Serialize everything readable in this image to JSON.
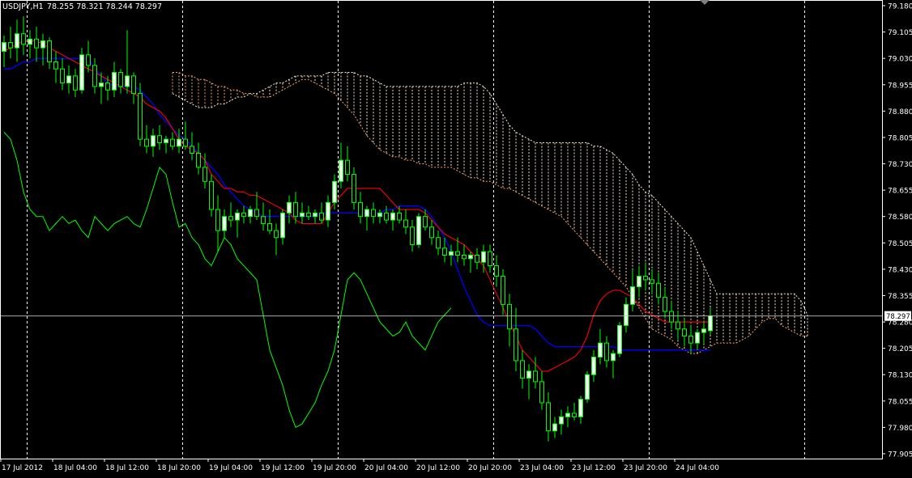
{
  "header": {
    "symbol": "USDJPY,H1",
    "ohlc": "78.255 78.321 78.244 78.297"
  },
  "current_price_label": "78.297",
  "colors": {
    "background": "#000000",
    "frame": "#ffffff",
    "grid": "#ffffff",
    "bull_candle": "#ffffff",
    "bear_candle": "#000000",
    "wick": "#00ff00",
    "tenkan": "#ff0000",
    "kijun": "#0000ff",
    "chikou": "#00ff00",
    "kumo_a": "#f4a460",
    "kumo_b": "#ffe4c4",
    "price_line": "#c0c0c0"
  },
  "chart_data": {
    "type": "candlestick-ichimoku",
    "timeframe": "H1",
    "y_ticks": [
      "79.180",
      "79.105",
      "79.030",
      "78.955",
      "78.880",
      "78.805",
      "78.730",
      "78.655",
      "78.580",
      "78.505",
      "78.430",
      "78.355",
      "78.280",
      "78.205",
      "78.130",
      "78.055",
      "77.980",
      "77.905"
    ],
    "ylim": [
      77.905,
      79.18
    ],
    "x_ticks": [
      "17 Jul 2012",
      "18 Jul 04:00",
      "18 Jul 12:00",
      "18 Jul 20:00",
      "19 Jul 04:00",
      "19 Jul 12:00",
      "19 Jul 20:00",
      "20 Jul 04:00",
      "20 Jul 12:00",
      "20 Jul 20:00",
      "23 Jul 04:00",
      "23 Jul 12:00",
      "23 Jul 20:00",
      "24 Jul 04:00"
    ],
    "x_tick_bars": [
      0,
      8,
      16,
      24,
      32,
      40,
      48,
      56,
      64,
      72,
      80,
      88,
      96,
      104
    ],
    "vertical_grid_bars": [
      3.5,
      27.5,
      51.5,
      75.5,
      99.5,
      123.5
    ],
    "total_bars": 133,
    "last_price": 78.297,
    "candles": [
      [
        79.05,
        79.095,
        79.005,
        79.075
      ],
      [
        79.075,
        79.12,
        79.03,
        79.06
      ],
      [
        79.06,
        79.14,
        79.02,
        79.1
      ],
      [
        79.1,
        79.15,
        79.04,
        79.07
      ],
      [
        79.07,
        79.11,
        79.03,
        79.085
      ],
      [
        79.085,
        79.12,
        79.02,
        79.06
      ],
      [
        79.06,
        79.1,
        79.01,
        79.08
      ],
      [
        79.08,
        79.09,
        79.0,
        79.02
      ],
      [
        79.02,
        79.05,
        78.96,
        79.0
      ],
      [
        79.0,
        79.03,
        78.94,
        78.96
      ],
      [
        78.96,
        79.01,
        78.93,
        78.98
      ],
      [
        78.98,
        79.0,
        78.92,
        78.94
      ],
      [
        78.94,
        79.06,
        78.93,
        79.04
      ],
      [
        79.04,
        79.08,
        78.99,
        79.01
      ],
      [
        79.01,
        79.03,
        78.93,
        78.95
      ],
      [
        78.95,
        78.99,
        78.9,
        78.96
      ],
      [
        78.96,
        78.98,
        78.91,
        78.94
      ],
      [
        78.94,
        79.02,
        78.92,
        78.99
      ],
      [
        78.99,
        79.0,
        78.93,
        78.95
      ],
      [
        78.95,
        79.11,
        78.93,
        78.98
      ],
      [
        78.98,
        78.99,
        78.9,
        78.93
      ],
      [
        78.93,
        78.96,
        78.78,
        78.8
      ],
      [
        78.8,
        78.84,
        78.76,
        78.78
      ],
      [
        78.78,
        78.83,
        78.75,
        78.81
      ],
      [
        78.81,
        78.84,
        78.77,
        78.79
      ],
      [
        78.79,
        78.81,
        78.76,
        78.8
      ],
      [
        78.8,
        78.82,
        78.77,
        78.78
      ],
      [
        78.78,
        78.83,
        78.76,
        78.8
      ],
      [
        78.8,
        78.85,
        78.77,
        78.78
      ],
      [
        78.78,
        78.82,
        78.74,
        78.76
      ],
      [
        78.76,
        78.79,
        78.7,
        78.72
      ],
      [
        78.72,
        78.76,
        78.66,
        78.68
      ],
      [
        78.68,
        78.7,
        78.58,
        78.6
      ],
      [
        78.6,
        78.64,
        78.48,
        78.54
      ],
      [
        78.54,
        78.6,
        78.52,
        78.58
      ],
      [
        78.58,
        78.62,
        78.55,
        78.57
      ],
      [
        78.57,
        78.6,
        78.52,
        78.59
      ],
      [
        78.59,
        78.61,
        78.56,
        78.58
      ],
      [
        78.58,
        78.61,
        78.56,
        78.6
      ],
      [
        78.6,
        78.65,
        78.57,
        78.58
      ],
      [
        78.58,
        78.62,
        78.54,
        78.56
      ],
      [
        78.56,
        78.6,
        78.53,
        78.54
      ],
      [
        78.54,
        78.56,
        78.47,
        78.52
      ],
      [
        78.52,
        78.6,
        78.5,
        78.59
      ],
      [
        78.59,
        78.64,
        78.56,
        78.62
      ],
      [
        78.62,
        78.65,
        78.56,
        78.58
      ],
      [
        78.58,
        78.62,
        78.56,
        78.59
      ],
      [
        78.59,
        78.61,
        78.57,
        78.58
      ],
      [
        78.58,
        78.6,
        78.56,
        78.59
      ],
      [
        78.59,
        78.62,
        78.56,
        78.57
      ],
      [
        78.57,
        78.64,
        78.55,
        78.62
      ],
      [
        78.62,
        78.7,
        78.6,
        78.68
      ],
      [
        78.68,
        78.79,
        78.66,
        78.74
      ],
      [
        78.74,
        78.78,
        78.68,
        78.7
      ],
      [
        78.7,
        78.72,
        78.6,
        78.62
      ],
      [
        78.62,
        78.65,
        78.56,
        78.58
      ],
      [
        78.58,
        78.61,
        78.54,
        78.6
      ],
      [
        78.6,
        78.62,
        78.56,
        78.58
      ],
      [
        78.58,
        78.6,
        78.56,
        78.59
      ],
      [
        78.59,
        78.61,
        78.56,
        78.57
      ],
      [
        78.57,
        78.6,
        78.54,
        78.59
      ],
      [
        78.59,
        78.61,
        78.56,
        78.57
      ],
      [
        78.57,
        78.6,
        78.53,
        78.55
      ],
      [
        78.55,
        78.57,
        78.48,
        78.5
      ],
      [
        78.5,
        78.59,
        78.49,
        78.58
      ],
      [
        78.58,
        78.6,
        78.54,
        78.55
      ],
      [
        78.55,
        78.57,
        78.5,
        78.52
      ],
      [
        78.52,
        78.54,
        78.47,
        78.49
      ],
      [
        78.49,
        78.52,
        78.45,
        78.47
      ],
      [
        78.47,
        78.5,
        78.44,
        78.48
      ],
      [
        78.48,
        78.52,
        78.45,
        78.47
      ],
      [
        78.47,
        78.5,
        78.44,
        78.46
      ],
      [
        78.46,
        78.48,
        78.42,
        78.47
      ],
      [
        78.47,
        78.49,
        78.43,
        78.45
      ],
      [
        78.45,
        78.5,
        78.42,
        78.48
      ],
      [
        78.48,
        78.5,
        78.42,
        78.44
      ],
      [
        78.44,
        78.47,
        78.38,
        78.41
      ],
      [
        78.41,
        78.43,
        78.3,
        78.33
      ],
      [
        78.33,
        78.36,
        78.21,
        78.26
      ],
      [
        78.26,
        78.32,
        78.14,
        78.17
      ],
      [
        78.17,
        78.2,
        78.09,
        78.12
      ],
      [
        78.12,
        78.16,
        78.06,
        78.14
      ],
      [
        78.14,
        78.18,
        78.09,
        78.11
      ],
      [
        78.11,
        78.14,
        78.03,
        78.05
      ],
      [
        78.05,
        78.08,
        77.94,
        77.97
      ],
      [
        77.97,
        78.01,
        77.95,
        77.99
      ],
      [
        77.99,
        78.03,
        77.96,
        78.01
      ],
      [
        78.01,
        78.04,
        77.98,
        78.02
      ],
      [
        78.02,
        78.05,
        78.0,
        78.01
      ],
      [
        78.01,
        78.07,
        77.99,
        78.06
      ],
      [
        78.06,
        78.14,
        78.05,
        78.13
      ],
      [
        78.13,
        78.2,
        78.11,
        78.18
      ],
      [
        78.18,
        78.26,
        78.16,
        78.22
      ],
      [
        78.22,
        78.24,
        78.15,
        78.17
      ],
      [
        78.17,
        78.2,
        78.12,
        78.19
      ],
      [
        78.19,
        78.28,
        78.18,
        78.27
      ],
      [
        78.27,
        78.35,
        78.25,
        78.33
      ],
      [
        78.33,
        78.43,
        78.31,
        78.38
      ],
      [
        78.38,
        78.44,
        78.35,
        78.41
      ],
      [
        78.41,
        78.45,
        78.37,
        78.4
      ],
      [
        78.4,
        78.43,
        78.36,
        78.39
      ],
      [
        78.39,
        78.42,
        78.33,
        78.35
      ],
      [
        78.35,
        78.38,
        78.29,
        78.31
      ],
      [
        78.31,
        78.34,
        78.26,
        78.28
      ],
      [
        78.28,
        78.31,
        78.23,
        78.26
      ],
      [
        78.26,
        78.29,
        78.21,
        78.24
      ],
      [
        78.24,
        78.27,
        78.19,
        78.22
      ],
      [
        78.22,
        78.26,
        78.2,
        78.25
      ],
      [
        78.25,
        78.28,
        78.22,
        78.26
      ],
      [
        78.255,
        78.321,
        78.244,
        78.297
      ]
    ],
    "tenkan": [
      79.05,
      79.06,
      79.07,
      79.08,
      79.08,
      79.08,
      79.07,
      79.06,
      79.05,
      79.04,
      79.03,
      79.02,
      79.01,
      79.0,
      78.99,
      78.98,
      78.97,
      78.96,
      78.95,
      78.94,
      78.93,
      78.92,
      78.9,
      78.89,
      78.88,
      78.86,
      78.83,
      78.8,
      78.78,
      78.77,
      78.76,
      78.74,
      78.7,
      78.68,
      78.66,
      78.66,
      78.65,
      78.65,
      78.64,
      78.64,
      78.63,
      78.62,
      78.61,
      78.6,
      78.59,
      78.57,
      78.56,
      78.56,
      78.56,
      78.56,
      78.59,
      78.62,
      78.64,
      78.66,
      78.66,
      78.66,
      78.66,
      78.66,
      78.66,
      78.64,
      78.62,
      78.6,
      78.6,
      78.6,
      78.6,
      78.59,
      78.57,
      78.55,
      78.53,
      78.52,
      78.51,
      78.5,
      78.48,
      78.46,
      78.44,
      78.4,
      78.36,
      78.32,
      78.28,
      78.24,
      78.2,
      78.18,
      78.16,
      78.14,
      78.14,
      78.15,
      78.16,
      78.17,
      78.18,
      78.2,
      78.24,
      78.3,
      78.34,
      78.36,
      78.37,
      78.37,
      78.36,
      78.35,
      78.33,
      78.31,
      78.3,
      78.29,
      78.28,
      78.28,
      78.28,
      78.28,
      78.28,
      78.28,
      78.28,
      78.28
    ],
    "kijun": [
      79.0,
      79.0,
      79.01,
      79.02,
      79.02,
      79.03,
      79.03,
      79.03,
      79.03,
      79.03,
      79.03,
      79.03,
      79.03,
      79.03,
      79.0,
      78.98,
      78.96,
      78.95,
      78.95,
      78.95,
      78.95,
      78.94,
      78.92,
      78.9,
      78.87,
      78.85,
      78.83,
      78.81,
      78.8,
      78.78,
      78.76,
      78.74,
      78.72,
      78.7,
      78.67,
      78.65,
      78.63,
      78.61,
      78.6,
      78.59,
      78.58,
      78.58,
      78.58,
      78.58,
      78.58,
      78.58,
      78.58,
      78.58,
      78.58,
      78.59,
      78.59,
      78.59,
      78.59,
      78.59,
      78.59,
      78.59,
      78.59,
      78.59,
      78.59,
      78.6,
      78.6,
      78.61,
      78.61,
      78.61,
      78.61,
      78.6,
      78.58,
      78.55,
      78.52,
      78.48,
      78.43,
      78.38,
      78.34,
      78.3,
      78.28,
      78.27,
      78.27,
      78.27,
      78.27,
      78.27,
      78.27,
      78.27,
      78.26,
      78.24,
      78.22,
      78.21,
      78.21,
      78.21,
      78.21,
      78.21,
      78.21,
      78.21,
      78.21,
      78.21,
      78.21,
      78.2,
      78.2,
      78.2,
      78.2,
      78.2,
      78.2,
      78.2,
      78.2,
      78.2,
      78.2,
      78.2,
      78.2,
      78.2,
      78.2,
      78.2
    ],
    "chikou": [
      78.82,
      78.8,
      78.74,
      78.65,
      78.6,
      78.58,
      78.58,
      78.54,
      78.56,
      78.58,
      78.56,
      78.57,
      78.54,
      78.52,
      78.58,
      78.56,
      78.54,
      78.56,
      78.57,
      78.58,
      78.56,
      78.55,
      78.6,
      78.66,
      78.72,
      78.7,
      78.62,
      78.55,
      78.56,
      78.52,
      78.5,
      78.46,
      78.44,
      78.48,
      78.52,
      78.5,
      78.46,
      78.44,
      78.42,
      78.4,
      78.3,
      78.2,
      78.15,
      78.1,
      78.03,
      77.98,
      77.99,
      78.02,
      78.05,
      78.1,
      78.14,
      78.2,
      78.3,
      78.4,
      78.42,
      78.4,
      78.36,
      78.32,
      78.28,
      78.26,
      78.24,
      78.25,
      78.28,
      78.24,
      78.22,
      78.2,
      78.24,
      78.28,
      78.3,
      78.32
    ],
    "span_a": [
      78.99,
      78.99,
      78.98,
      78.98,
      78.97,
      78.97,
      78.96,
      78.95,
      78.95,
      78.94,
      78.94,
      78.93,
      78.93,
      78.92,
      78.92,
      78.92,
      78.93,
      78.94,
      78.95,
      78.96,
      78.97,
      78.97,
      78.96,
      78.95,
      78.94,
      78.93,
      78.91,
      78.89,
      78.87,
      78.84,
      78.81,
      78.79,
      78.77,
      78.76,
      78.75,
      78.75,
      78.74,
      78.74,
      78.73,
      78.73,
      78.72,
      78.72,
      78.72,
      78.72,
      78.71,
      78.7,
      78.69,
      78.69,
      78.68,
      78.68,
      78.67,
      78.66,
      78.66,
      78.65,
      78.64,
      78.63,
      78.62,
      78.61,
      78.6,
      78.59,
      78.58,
      78.56,
      78.54,
      78.52,
      78.5,
      78.48,
      78.46,
      78.44,
      78.42,
      78.4,
      78.38,
      78.35,
      78.32,
      78.29,
      78.26,
      78.25,
      78.24,
      78.23,
      78.21,
      78.2,
      78.19,
      78.19,
      78.2,
      78.21,
      78.22,
      78.22,
      78.22,
      78.22,
      78.23,
      78.24,
      78.26,
      78.28,
      78.29,
      78.29,
      78.27,
      78.26,
      78.25,
      78.24,
      78.24
    ],
    "span_b": [
      78.93,
      78.92,
      78.91,
      78.9,
      78.89,
      78.89,
      78.89,
      78.9,
      78.9,
      78.91,
      78.92,
      78.92,
      78.93,
      78.93,
      78.94,
      78.95,
      78.96,
      78.96,
      78.97,
      78.98,
      78.98,
      78.98,
      78.98,
      78.98,
      78.99,
      78.99,
      78.99,
      78.99,
      78.99,
      78.98,
      78.98,
      78.97,
      78.96,
      78.95,
      78.95,
      78.95,
      78.95,
      78.95,
      78.95,
      78.95,
      78.95,
      78.95,
      78.95,
      78.95,
      78.95,
      78.96,
      78.96,
      78.96,
      78.95,
      78.93,
      78.9,
      78.87,
      78.84,
      78.82,
      78.81,
      78.8,
      78.79,
      78.79,
      78.79,
      78.79,
      78.79,
      78.79,
      78.79,
      78.79,
      78.79,
      78.78,
      78.78,
      78.77,
      78.76,
      78.74,
      78.72,
      78.7,
      78.67,
      78.65,
      78.64,
      78.62,
      78.6,
      78.58,
      78.56,
      78.54,
      78.52,
      78.48,
      78.44,
      78.4,
      78.36,
      78.36,
      78.36,
      78.36,
      78.36,
      78.36,
      78.36,
      78.36,
      78.36,
      78.36,
      78.36,
      78.36,
      78.36,
      78.34,
      78.3
    ]
  }
}
